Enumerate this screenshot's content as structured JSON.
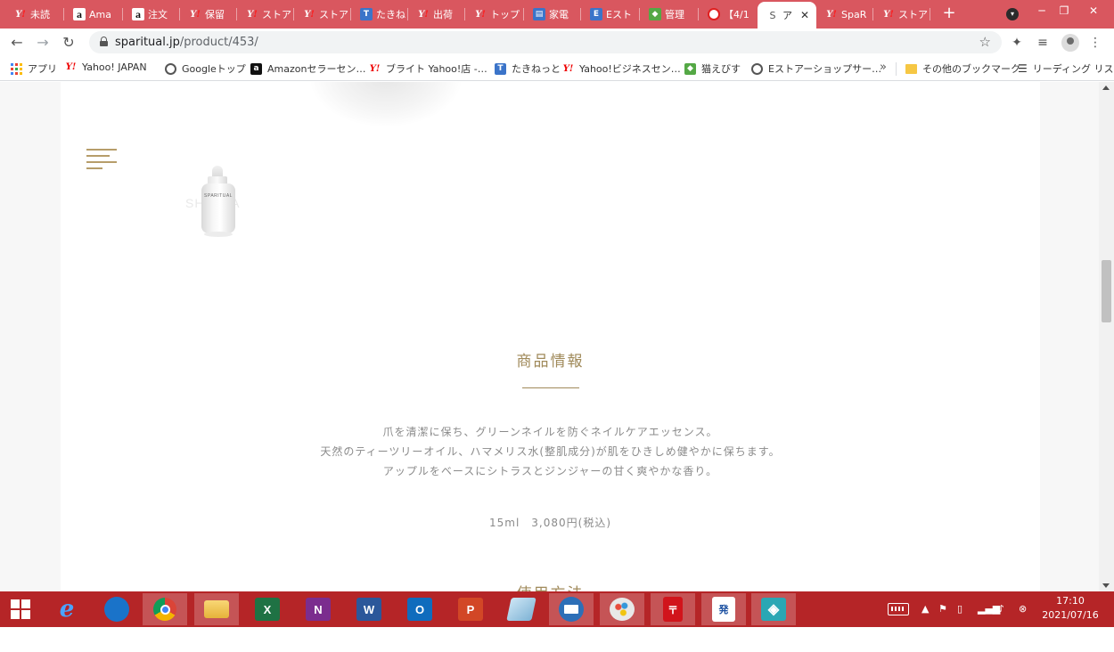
{
  "browser": {
    "tabs": [
      {
        "label": "未読",
        "icon": "yahoo-icon"
      },
      {
        "label": "Ama",
        "icon": "amazon-icon"
      },
      {
        "label": "注文",
        "icon": "amazon-icon"
      },
      {
        "label": "保留",
        "icon": "yahoo-icon"
      },
      {
        "label": "ストア",
        "icon": "yahoo-icon"
      },
      {
        "label": "ストア",
        "icon": "yahoo-icon"
      },
      {
        "label": "たきね",
        "icon": "takine-icon"
      },
      {
        "label": "出荷",
        "icon": "yahoo-icon"
      },
      {
        "label": "トップ",
        "icon": "yahoo-icon"
      },
      {
        "label": "家電",
        "icon": "document-icon"
      },
      {
        "label": "Eスト",
        "icon": "store-icon"
      },
      {
        "label": "管理",
        "icon": "cat-icon"
      },
      {
        "label": "【4/1",
        "icon": "red-circle-icon"
      },
      {
        "label": "ア",
        "icon": "sparitual-icon",
        "active": true
      },
      {
        "label": "SpaR",
        "icon": "yahoo-icon"
      },
      {
        "label": "ストア",
        "icon": "yahoo-icon"
      }
    ],
    "active_tab_favicon": "S",
    "url_domain": "sparitual.jp",
    "url_path": "/product/453/",
    "bookmarks": [
      {
        "label": "アプリ",
        "icon": "apps-grid-icon"
      },
      {
        "label": "Yahoo! JAPAN",
        "icon": "yahoo-icon"
      },
      {
        "label": "Googleトップ",
        "icon": "globe-icon"
      },
      {
        "label": "Amazonセラーセン…",
        "icon": "amazon-icon"
      },
      {
        "label": "ブライト Yahoo!店 -…",
        "icon": "yahoo-icon"
      },
      {
        "label": "たきねっと",
        "icon": "takine-icon"
      },
      {
        "label": "Yahoo!ビジネスセン…",
        "icon": "yahoo-icon"
      },
      {
        "label": "猫えびす",
        "icon": "cat-icon"
      },
      {
        "label": "Eストアーショップサー…",
        "icon": "globe-icon"
      }
    ],
    "bookmark_overflow": "»",
    "other_bookmarks": "その他のブックマーク",
    "reading_list": "リーディング リスト"
  },
  "page": {
    "product_section_title": "商品情報",
    "description_lines": [
      "爪を清潔に保ち、グリーンネイルを防ぐネイルケアエッセンス。",
      "天然のティーツリーオイル、ハマメリス水(整肌成分)が肌をひきしめ健やかに保ちます。",
      "アップルをベースにシトラスとジンジャーの甘く爽やかな香り。"
    ],
    "price": "15ml　3,080円(税込)",
    "usage_section_title": "使用方法",
    "bottle_label": "SPARITUAL",
    "watermark": "SHNAYA"
  },
  "taskbar": {
    "apps": [
      {
        "name": "internet-explorer-icon",
        "glyph": "e",
        "color": "#1e90ff"
      },
      {
        "name": "edge-icon",
        "glyph": "e",
        "color": "#1a73c9"
      },
      {
        "name": "chrome-icon",
        "glyph": "",
        "color": "#db4437"
      },
      {
        "name": "file-explorer-icon",
        "glyph": "",
        "color": "#f5c542"
      },
      {
        "name": "excel-icon",
        "glyph": "X",
        "color": "#1f7244"
      },
      {
        "name": "onenote-icon",
        "glyph": "N",
        "color": "#7b2d8e"
      },
      {
        "name": "word-icon",
        "glyph": "W",
        "color": "#2b579a"
      },
      {
        "name": "outlook-icon",
        "glyph": "O",
        "color": "#0f6cbd"
      },
      {
        "name": "powerpoint-icon",
        "glyph": "P",
        "color": "#d24726"
      },
      {
        "name": "notepad-icon",
        "glyph": "",
        "color": "#7fb3d5"
      },
      {
        "name": "mail-app-icon",
        "glyph": "",
        "color": "#2d6fb7"
      },
      {
        "name": "paint-icon",
        "glyph": "",
        "color": "#e8e8e8"
      },
      {
        "name": "postbox-icon",
        "glyph": "〒",
        "color": "#d1141b"
      },
      {
        "name": "shipping-app-icon",
        "glyph": "発",
        "color": "#ffffff"
      },
      {
        "name": "remote-app-icon",
        "glyph": "◈",
        "color": "#2aa7b4"
      }
    ],
    "time": "17:10",
    "date": "2021/07/16"
  }
}
